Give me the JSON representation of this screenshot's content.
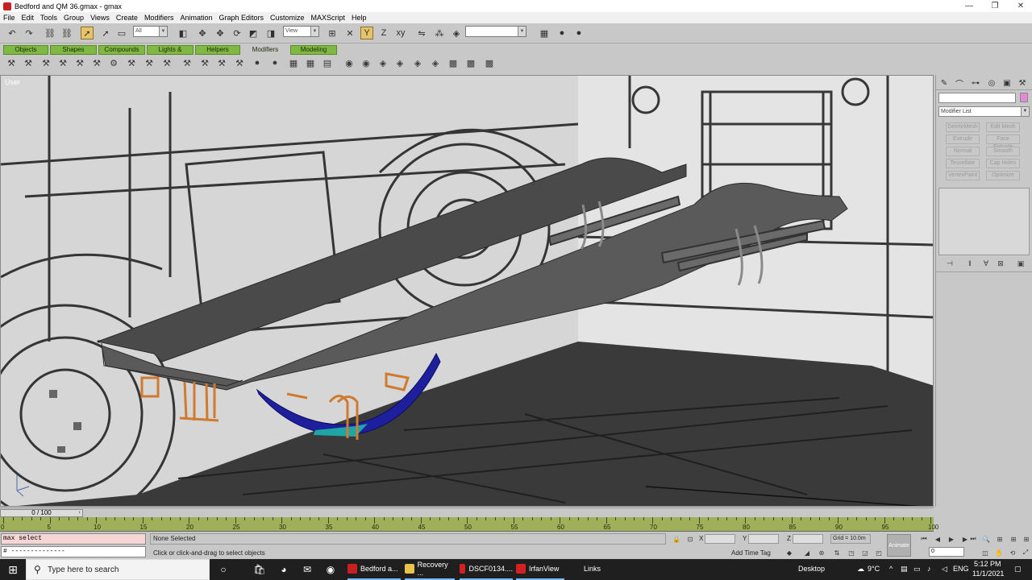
{
  "window": {
    "title": "Bedford and QM 36.gmax - gmax",
    "min_label": "—",
    "restore_label": "❐",
    "close_label": "✕"
  },
  "menu": [
    "File",
    "Edit",
    "Tools",
    "Group",
    "Views",
    "Create",
    "Modifiers",
    "Animation",
    "Graph Editors",
    "Customize",
    "MAXScript",
    "Help"
  ],
  "toolbar": {
    "selection_filter": "All",
    "ref_coord": "View",
    "named_selection": ""
  },
  "tabs": [
    "Objects",
    "Shapes",
    "Compounds",
    "Lights & Cameras",
    "Helpers",
    "Modifiers",
    "Modeling"
  ],
  "active_tab": "Modifiers",
  "viewport": {
    "label": "User",
    "axis_label": "xyz"
  },
  "command_panel": {
    "object_color": "#e489d6",
    "modifier_list": "Modifier List",
    "modifier_buttons": [
      [
        "DeleteMesh",
        "Edit Mesh"
      ],
      [
        "Extrude",
        "Face Extrude"
      ],
      [
        "Normal",
        "Smooth"
      ],
      [
        "Tessellate",
        "Cap Holes"
      ],
      [
        "VertexPaint",
        "Optimize"
      ]
    ]
  },
  "time_slider": {
    "current": "0",
    "total": "100",
    "display": "0 / 100"
  },
  "track": {
    "labels": [
      "0",
      "5",
      "10",
      "15",
      "20",
      "25",
      "30",
      "35",
      "40",
      "45",
      "50",
      "55",
      "60",
      "65",
      "70",
      "75",
      "80",
      "85",
      "90",
      "95",
      "100"
    ]
  },
  "status": {
    "maxscript_line1": "max select",
    "maxscript_line2": "# --------------",
    "selection": "None Selected",
    "prompt": "Click or click-and-drag to select objects",
    "x_label": "X",
    "y_label": "Y",
    "z_label": "Z",
    "grid": "Grid = 10.0m",
    "add_time_tag": "Add Time Tag",
    "animate": "Animate",
    "frame": "0"
  },
  "taskbar": {
    "search_placeholder": "Type here to search",
    "apps": [
      "Bedford a...",
      "Recovery ...",
      "DSCF0134....",
      "IrfanView"
    ],
    "links": "Links",
    "desktop": "Desktop",
    "weather": "9°C",
    "language": "ENG",
    "time": "5:12 PM",
    "date": "11/1/2021"
  }
}
